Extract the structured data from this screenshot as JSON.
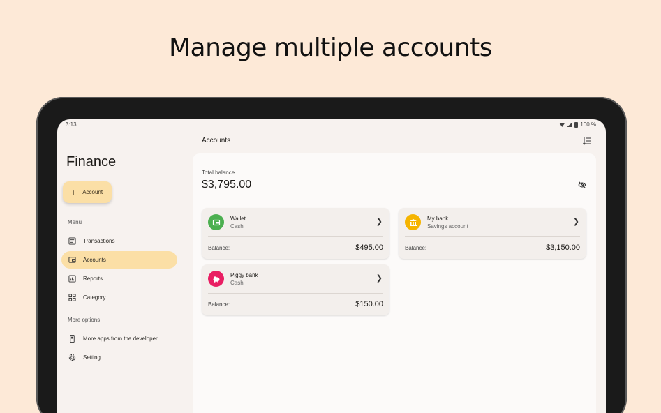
{
  "headline": "Manage multiple accounts",
  "status": {
    "time": "3:13",
    "battery": "100 %"
  },
  "app": {
    "title": "Finance"
  },
  "fab": {
    "label": "Account"
  },
  "menu": {
    "section_label": "Menu",
    "items": [
      {
        "label": "Transactions",
        "icon": "list-icon",
        "active": false
      },
      {
        "label": "Accounts",
        "icon": "wallet-icon",
        "active": true
      },
      {
        "label": "Reports",
        "icon": "chart-icon",
        "active": false
      },
      {
        "label": "Category",
        "icon": "grid-icon",
        "active": false
      }
    ]
  },
  "more": {
    "section_label": "More options",
    "items": [
      {
        "label": "More apps from the developer",
        "icon": "phone-icon"
      },
      {
        "label": "Setting",
        "icon": "gear-icon"
      }
    ]
  },
  "main": {
    "title": "Accounts",
    "total_label": "Total balance",
    "total_value": "$3,795.00",
    "balance_label": "Balance:",
    "accounts": [
      {
        "name": "Wallet",
        "type": "Cash",
        "balance": "$495.00",
        "color": "#4caf50",
        "icon": "wallet-icon"
      },
      {
        "name": "My bank",
        "type": "Savings account",
        "balance": "$3,150.00",
        "color": "#f5b400",
        "icon": "bank-icon"
      },
      {
        "name": "Piggy bank",
        "type": "Cash",
        "balance": "$150.00",
        "color": "#e91e63",
        "icon": "piggy-bank-icon"
      }
    ]
  },
  "colors": {
    "background": "#fde9d7",
    "accent": "#fbdfa6",
    "screen": "#f7f2ef"
  }
}
